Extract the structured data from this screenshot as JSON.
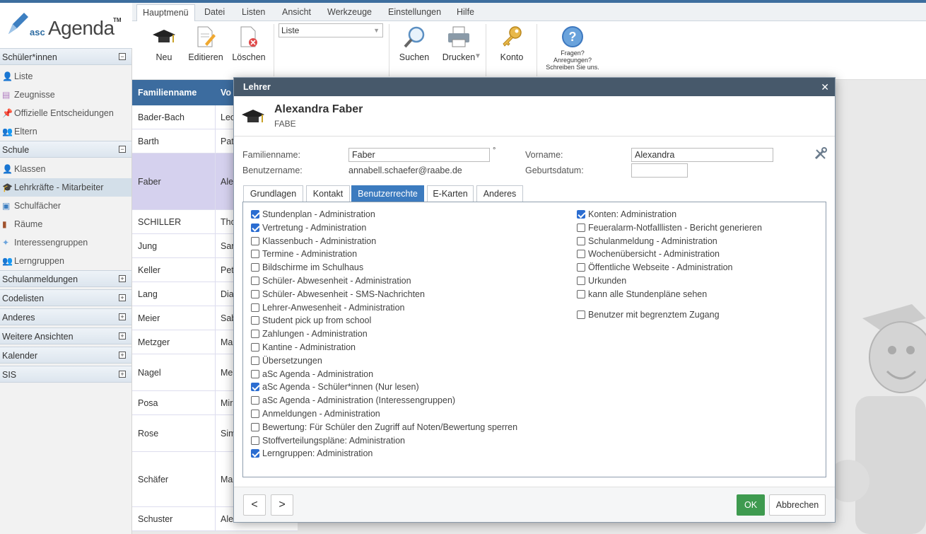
{
  "app": {
    "logo_prefix": "asc",
    "logo_name": "Agenda",
    "logo_tm": "TM"
  },
  "sidebar": {
    "sections": [
      {
        "label": "Schüler*innen",
        "toggle": "−"
      },
      {
        "label": "Schule",
        "toggle": "−"
      },
      {
        "label": "Schulanmeldungen",
        "toggle": "+"
      },
      {
        "label": "Codelisten",
        "toggle": "+"
      },
      {
        "label": "Anderes",
        "toggle": "+"
      },
      {
        "label": "Weitere Ansichten",
        "toggle": "+"
      },
      {
        "label": "Kalender",
        "toggle": "+"
      },
      {
        "label": "SIS",
        "toggle": "+"
      }
    ],
    "schueler_items": [
      "Liste",
      "Zeugnisse",
      "Offizielle Entscheidungen",
      "Eltern"
    ],
    "schule_items": [
      "Klassen",
      "Lehrkräfte - Mitarbeiter",
      "Schulfächer",
      "Räume",
      "Interessengruppen",
      "Lerngruppen"
    ]
  },
  "menubar": {
    "tabs": [
      "Hauptmenü",
      "Datei",
      "Listen",
      "Ansicht",
      "Werkzeuge",
      "Einstellungen",
      "Hilfe"
    ]
  },
  "toolbar": {
    "neu": "Neu",
    "editieren": "Editieren",
    "loeschen": "Löschen",
    "view_select": "Liste",
    "suchen": "Suchen",
    "drucken": "Drucken",
    "konto": "Konto",
    "help_lines": [
      "Fragen?",
      "Anregungen?",
      "Schreiben Sie uns."
    ]
  },
  "table": {
    "headers": [
      "Familienname",
      "Vo"
    ],
    "rows": [
      [
        "Bader-Bach",
        "Leo"
      ],
      [
        "Barth",
        "Pat"
      ],
      [
        "Faber",
        "Ale"
      ],
      [
        "SCHILLER",
        "Tho"
      ],
      [
        "Jung",
        "San"
      ],
      [
        "Keller",
        "Pet"
      ],
      [
        "Lang",
        "Dia"
      ],
      [
        "Meier",
        "Sab"
      ],
      [
        "Metzger",
        "Ma"
      ],
      [
        "Nagel",
        "Me"
      ],
      [
        "Posa",
        "Mir"
      ],
      [
        "Rose",
        "Sim"
      ],
      [
        "Schäfer",
        "Ma"
      ],
      [
        "Schuster",
        "Ale"
      ]
    ]
  },
  "dialog": {
    "title": "Lehrer",
    "close": "✕",
    "name": "Alexandra Faber",
    "code": "FABE",
    "labels": {
      "familienname": "Familienname:",
      "vorname": "Vorname:",
      "benutzername": "Benutzername:",
      "geburtsdatum": "Geburtsdatum:"
    },
    "familienname": "Faber",
    "degree": "°",
    "vorname": "Alexandra",
    "benutzername": "annabell.schaefer@raabe.de",
    "geburtsdatum": "",
    "tabs": [
      "Grundlagen",
      "Kontakt",
      "Benutzerrechte",
      "E-Karten",
      "Anderes"
    ],
    "active_tab": "Benutzerrechte",
    "left_perms": [
      {
        "label": "Stundenplan - Administration",
        "checked": true
      },
      {
        "label": "Vertretung - Administration",
        "checked": true
      },
      {
        "label": "Klassenbuch - Administration",
        "checked": false
      },
      {
        "label": "Termine - Administration",
        "checked": false
      },
      {
        "label": "Bildschirme im Schulhaus",
        "checked": false
      },
      {
        "label": "Schüler- Abwesenheit - Administration",
        "checked": false
      },
      {
        "label": "Schüler- Abwesenheit - SMS-Nachrichten",
        "checked": false
      },
      {
        "label": "Lehrer-Anwesenheit - Administration",
        "checked": false
      },
      {
        "label": "Student pick up from school",
        "checked": false
      },
      {
        "label": "Zahlungen - Administration",
        "checked": false
      },
      {
        "label": "Kantine - Administration",
        "checked": false
      },
      {
        "label": "Übersetzungen",
        "checked": false
      },
      {
        "label": "aSc Agenda - Administration",
        "checked": false
      },
      {
        "label": "aSc Agenda - Schüler*innen (Nur lesen)",
        "checked": true
      },
      {
        "label": "aSc Agenda - Administration (Interessengruppen)",
        "checked": false
      },
      {
        "label": "Anmeldungen - Administration",
        "checked": false
      },
      {
        "label": "Bewertung: Für Schüler den Zugriff auf Noten/Bewertung sperren",
        "checked": false
      },
      {
        "label": "Stoffverteilungspläne: Administration",
        "checked": false
      },
      {
        "label": "Lerngruppen: Administration",
        "checked": true
      }
    ],
    "right_perms": [
      {
        "label": "Konten: Administration",
        "checked": true
      },
      {
        "label": "Feueralarm-Notfalllisten - Bericht generieren",
        "checked": false
      },
      {
        "label": "Schulanmeldung - Administration",
        "checked": false
      },
      {
        "label": "Wochenübersicht - Administration",
        "checked": false
      },
      {
        "label": "Öffentliche Webseite - Administration",
        "checked": false
      },
      {
        "label": "Urkunden",
        "checked": false
      },
      {
        "label": "kann alle Stundenpläne sehen",
        "checked": false
      }
    ],
    "extra_perm": {
      "label": "Benutzer mit begrenztem Zugang",
      "checked": false
    },
    "prev": "<",
    "next": ">",
    "ok": "OK",
    "cancel": "Abbrechen"
  },
  "colors": {
    "header_blue": "#3c6c9f",
    "active_tab": "#3c7bbf",
    "ok_green": "#3e9a4f",
    "dialog_title": "#47596b",
    "selected_row": "#d5d1ee"
  }
}
